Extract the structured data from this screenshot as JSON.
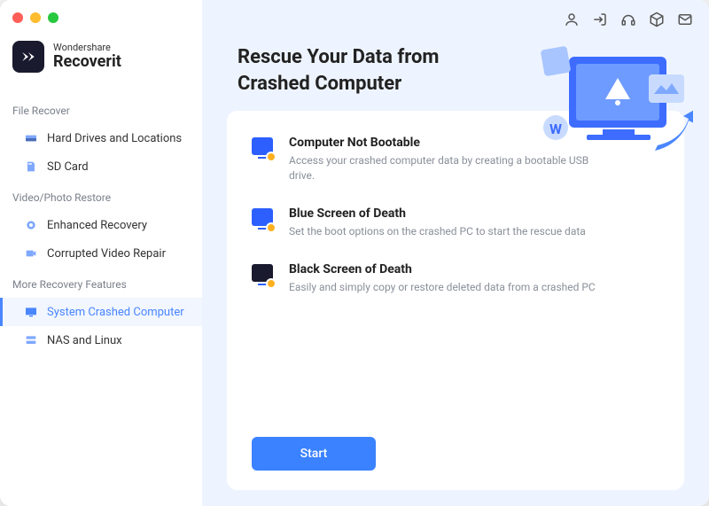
{
  "brand": {
    "sub": "Wondershare",
    "main": "Recoverit"
  },
  "sections": {
    "file_recover": {
      "label": "File Recover",
      "items": [
        {
          "label": "Hard Drives and Locations"
        },
        {
          "label": "SD Card"
        }
      ]
    },
    "video_photo": {
      "label": "Video/Photo Restore",
      "items": [
        {
          "label": "Enhanced Recovery"
        },
        {
          "label": "Corrupted Video Repair"
        }
      ]
    },
    "more": {
      "label": "More Recovery Features",
      "items": [
        {
          "label": "System Crashed Computer"
        },
        {
          "label": "NAS and Linux"
        }
      ]
    }
  },
  "main": {
    "title": "Rescue Your Data from Crashed Computer",
    "options": [
      {
        "title": "Computer Not Bootable",
        "desc": "Access your crashed computer data by creating a bootable USB drive."
      },
      {
        "title": "Blue Screen of Death",
        "desc": "Set the boot options on the crashed PC to start the rescue data"
      },
      {
        "title": "Black Screen of Death",
        "desc": "Easily and simply copy or restore deleted data from a crashed PC"
      }
    ],
    "start_label": "Start"
  }
}
